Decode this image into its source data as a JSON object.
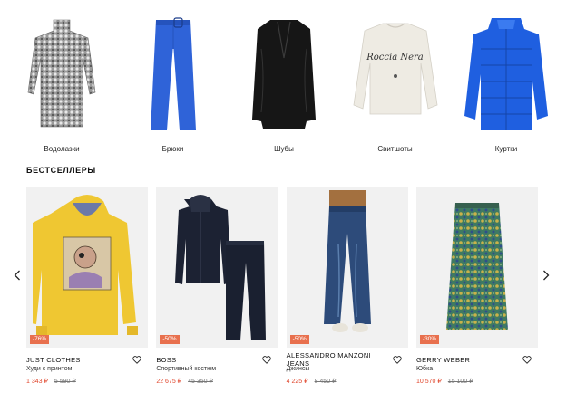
{
  "categories": [
    {
      "label": "Водолазки",
      "icon": "turtleneck-image"
    },
    {
      "label": "Брюки",
      "icon": "trousers-image"
    },
    {
      "label": "Шубы",
      "icon": "fur-coat-image"
    },
    {
      "label": "Свитшоты",
      "icon": "sweatshirt-image"
    },
    {
      "label": "Куртки",
      "icon": "puffer-jacket-image"
    }
  ],
  "sweatshirt_print": {
    "line1": "Roccia Nera"
  },
  "bestsellers": {
    "title": "БЕСТСЕЛЛЕРЫ",
    "prev_icon": "chevron-left-icon",
    "next_icon": "chevron-right-icon",
    "products": [
      {
        "brand": "JUST CLOTHES",
        "name": "Худи с принтом",
        "price": "1 343 ₽",
        "old_price": "5 590 ₽",
        "discount": "-76%"
      },
      {
        "brand": "BOSS",
        "name": "Спортивный костюм",
        "price": "22 675 ₽",
        "old_price": "45 350 ₽",
        "discount": "-50%"
      },
      {
        "brand": "ALESSANDRO MANZONI JEANS",
        "name": "Джинсы",
        "price": "4 225 ₽",
        "old_price": "8 450 ₽",
        "discount": "-50%"
      },
      {
        "brand": "GERRY WEBER",
        "name": "Юбка",
        "price": "10 570 ₽",
        "old_price": "15 100 ₽",
        "discount": "-30%"
      }
    ]
  },
  "colors": {
    "accent": "#e0452b",
    "badge": "#e8704e",
    "card_bg": "#f1f1f1"
  }
}
